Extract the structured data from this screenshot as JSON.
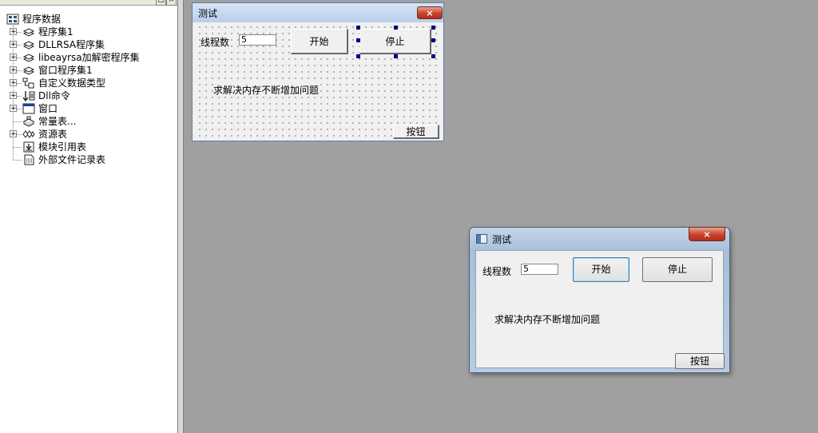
{
  "tree": {
    "root": "程序数据",
    "items": [
      {
        "label": "程序集1",
        "icon": "program-set-icon",
        "expandable": true
      },
      {
        "label": "DLLRSA程序集",
        "icon": "program-set-icon",
        "expandable": true
      },
      {
        "label": "libeayrsa加解密程序集",
        "icon": "program-set-icon",
        "expandable": true
      },
      {
        "label": "窗口程序集1",
        "icon": "program-set-icon",
        "expandable": true
      },
      {
        "label": "自定义数据类型",
        "icon": "data-type-icon",
        "expandable": true
      },
      {
        "label": "Dll命令",
        "icon": "dll-command-icon",
        "expandable": true
      },
      {
        "label": "窗口",
        "icon": "window-icon",
        "expandable": true
      },
      {
        "label": "常量表...",
        "icon": "constant-table-icon",
        "expandable": false
      },
      {
        "label": "资源表",
        "icon": "resource-table-icon",
        "expandable": true
      },
      {
        "label": "模块引用表",
        "icon": "module-ref-icon",
        "expandable": false
      },
      {
        "label": "外部文件记录表",
        "icon": "external-file-icon",
        "expandable": false
      }
    ]
  },
  "design_form": {
    "title": "测试",
    "close": "×",
    "thread_label": "线程数",
    "thread_value": "5",
    "start_label": "开始",
    "stop_label": "停止",
    "description": "求解决内存不断增加问题",
    "button_label": "按钮"
  },
  "run_window": {
    "title": "测试",
    "close": "×",
    "thread_label": "线程数",
    "thread_value": "5",
    "start_label": "开始",
    "stop_label": "停止",
    "description": "求解决内存不断增加问题",
    "button_label": "按钮"
  },
  "colors": {
    "workspace": "#a0a0a0",
    "close_button": "#c7432a",
    "selection_handle": "#000080"
  }
}
